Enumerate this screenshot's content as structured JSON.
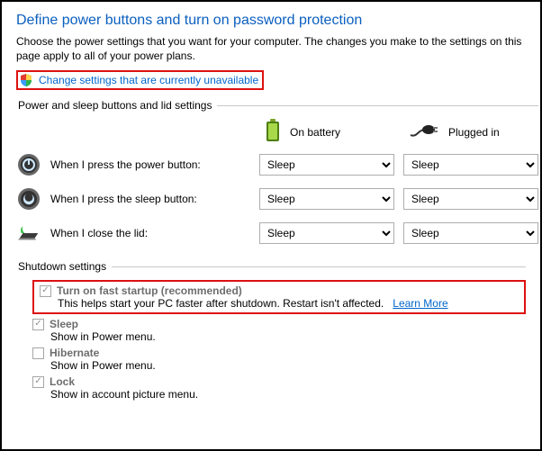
{
  "title": "Define power buttons and turn on password protection",
  "subtitle": "Choose the power settings that you want for your computer. The changes you make to the settings on this page apply to all of your power plans.",
  "change_link": "Change settings that are currently unavailable",
  "group1": {
    "legend": "Power and sleep buttons and lid settings",
    "cols": {
      "battery": "On battery",
      "plugged": "Plugged in"
    },
    "rows": {
      "power": {
        "label": "When I press the power button:",
        "battery": "Sleep",
        "plugged": "Sleep"
      },
      "sleep": {
        "label": "When I press the sleep button:",
        "battery": "Sleep",
        "plugged": "Sleep"
      },
      "lid": {
        "label": "When I close the lid:",
        "battery": "Sleep",
        "plugged": "Sleep"
      }
    }
  },
  "group2": {
    "legend": "Shutdown settings",
    "fast": {
      "label": "Turn on fast startup (recommended)",
      "desc": "This helps start your PC faster after shutdown. Restart isn't affected.",
      "learn": "Learn More"
    },
    "sleep": {
      "label": "Sleep",
      "desc": "Show in Power menu."
    },
    "hiber": {
      "label": "Hibernate",
      "desc": "Show in Power menu."
    },
    "lock": {
      "label": "Lock",
      "desc": "Show in account picture menu."
    }
  }
}
